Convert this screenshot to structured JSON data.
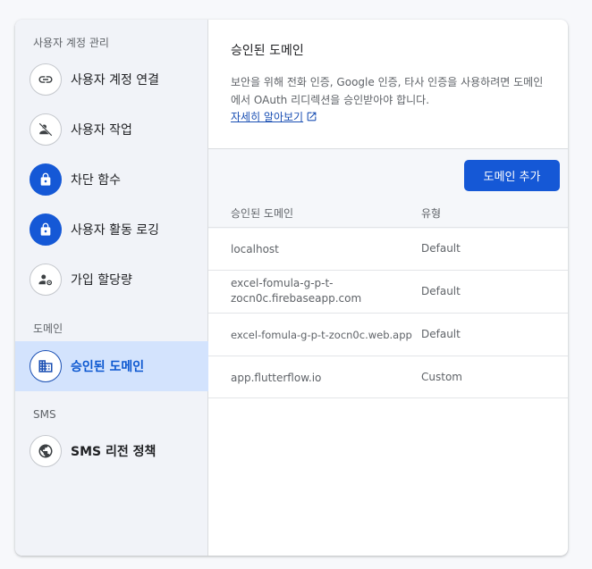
{
  "sidebar": {
    "section_user_accounts": "사용자 계정 관리",
    "section_domain": "도메인",
    "section_sms": "SMS",
    "items": [
      {
        "label": "사용자 계정 연결",
        "icon": "link-icon"
      },
      {
        "label": "사용자 작업",
        "icon": "person-off-icon"
      },
      {
        "label": "차단 함수",
        "icon": "lock-icon"
      },
      {
        "label": "사용자 활동 로깅",
        "icon": "lock-icon"
      },
      {
        "label": "가입 할당량",
        "icon": "person-settings-icon"
      },
      {
        "label": "승인된 도메인",
        "icon": "building-icon",
        "active": true
      },
      {
        "label": "SMS 리전 정책",
        "icon": "globe-icon"
      }
    ]
  },
  "main": {
    "title": "승인된 도메인",
    "description": "보안을 위해 전화 인증, Google 인증, 타사 인증을 사용하려면 도메인에서 OAuth 리디렉션을 승인받아야 합니다.",
    "learn_more": "자세히 알아보기",
    "add_button": "도메인 추가",
    "table": {
      "headers": [
        "승인된 도메인",
        "유형"
      ],
      "rows": [
        {
          "domain": "localhost",
          "type": "Default"
        },
        {
          "domain_line1": "excel-fomula-g-p-t-",
          "domain_line2": "zocn0c.firebaseapp.com",
          "type": "Default"
        },
        {
          "domain": "excel-fomula-g-p-t-zocn0c.web.app",
          "type": "Default"
        },
        {
          "domain": "app.flutterflow.io",
          "type": "Custom"
        }
      ]
    }
  },
  "colors": {
    "accent": "#1558d6",
    "active_bg": "#d3e3fd",
    "link": "#1a4fb3"
  }
}
